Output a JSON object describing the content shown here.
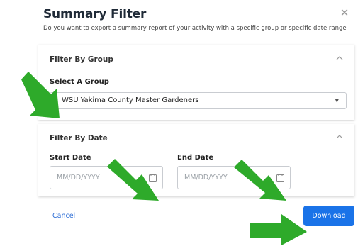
{
  "dialog": {
    "title": "Summary Filter",
    "subtitle": "Do you want to export a summary report of your activity with a specific group or specific date range",
    "close_icon": "close-icon"
  },
  "group_section": {
    "title": "Filter By Group",
    "select_label": "Select A Group",
    "selected_group": "WSU Yakima County Master Gardeners"
  },
  "date_section": {
    "title": "Filter By Date",
    "start_label": "Start Date",
    "end_label": "End Date",
    "start_placeholder": "MM/DD/YYYY",
    "end_placeholder": "MM/DD/YYYY"
  },
  "footer": {
    "cancel_label": "Cancel",
    "download_label": "Download"
  },
  "colors": {
    "accent": "#1a73e8",
    "link": "#2f6fd6",
    "annotation_arrow": "#2eaa2a"
  }
}
